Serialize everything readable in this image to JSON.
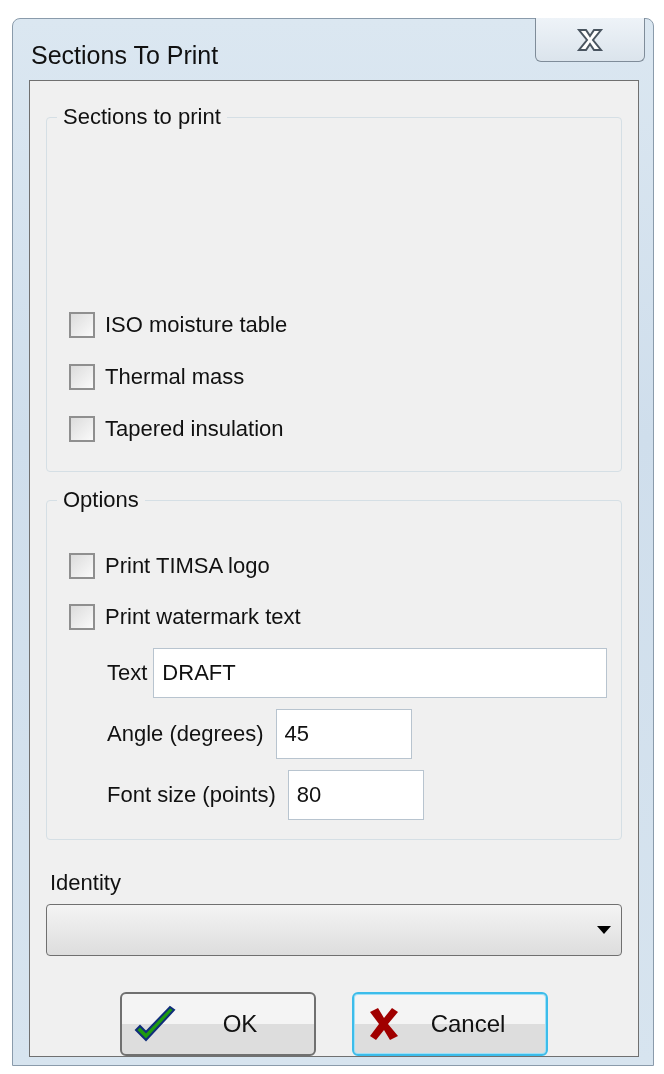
{
  "window": {
    "title": "Sections To Print"
  },
  "sections_group": {
    "legend": "Sections to print",
    "checkboxes": [
      {
        "label": "ISO moisture table",
        "checked": false
      },
      {
        "label": "Thermal mass",
        "checked": false
      },
      {
        "label": "Tapered insulation",
        "checked": false
      }
    ]
  },
  "options_group": {
    "legend": "Options",
    "checkboxes": [
      {
        "label": "Print TIMSA logo",
        "checked": false
      },
      {
        "label": "Print watermark text",
        "checked": false
      }
    ],
    "fields": [
      {
        "label": "Text",
        "value": "DRAFT",
        "kind": "wide"
      },
      {
        "label": "Angle (degrees)",
        "value": "45",
        "kind": "narrow"
      },
      {
        "label": "Font size (points)",
        "value": "80",
        "kind": "narrow"
      }
    ]
  },
  "identity": {
    "label": "Identity"
  },
  "buttons": [
    {
      "label": "OK",
      "kind": "ok",
      "focused": false
    },
    {
      "label": "Cancel",
      "kind": "cancel",
      "focused": true
    }
  ]
}
